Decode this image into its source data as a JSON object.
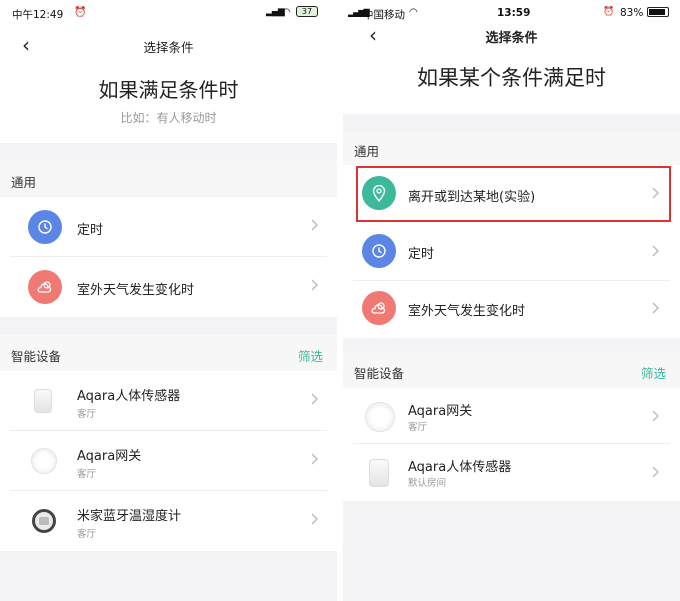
{
  "left": {
    "status": {
      "time": "中午12:49",
      "battery": "37"
    },
    "nav_title": "选择条件",
    "big_title": "如果满足条件时",
    "hint": "比如：有人移动时",
    "section_general": "通用",
    "general_items": [
      {
        "label": "定时",
        "icon": "clock-icon"
      },
      {
        "label": "室外天气发生变化时",
        "icon": "weather-icon"
      }
    ],
    "section_devices": "智能设备",
    "filter": "筛选",
    "devices": [
      {
        "name": "Aqara人体传感器",
        "room": "客厅",
        "icon": "motion-sensor-icon"
      },
      {
        "name": "Aqara网关",
        "room": "客厅",
        "icon": "gateway-icon"
      },
      {
        "name": "米家蓝牙温湿度计",
        "room": "客厅",
        "icon": "thermometer-icon"
      }
    ]
  },
  "right": {
    "status": {
      "carrier": "中国移动",
      "time": "13:59",
      "battery": "83%"
    },
    "nav_title": "选择条件",
    "big_title": "如果某个条件满足时",
    "section_general": "通用",
    "general_items": [
      {
        "label": "离开或到达某地(实验)",
        "icon": "location-pin-icon"
      },
      {
        "label": "定时",
        "icon": "clock-icon"
      },
      {
        "label": "室外天气发生变化时",
        "icon": "weather-icon"
      }
    ],
    "section_devices": "智能设备",
    "filter": "筛选",
    "devices": [
      {
        "name": "Aqara网关",
        "room": "客厅",
        "icon": "gateway-icon"
      },
      {
        "name": "Aqara人体传感器",
        "room": "默认房间",
        "icon": "motion-sensor-icon"
      }
    ]
  },
  "colors": {
    "accent": "#3cb79c",
    "clock": "#5b86e5",
    "weather": "#f07a73",
    "location": "#3cb89b",
    "highlight": "#dd3333"
  }
}
